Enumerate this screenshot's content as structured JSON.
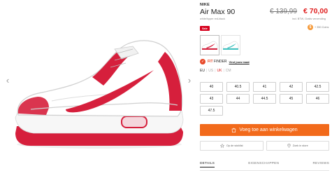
{
  "product": {
    "brand": "NIKE",
    "model": "Air Max 90",
    "old_price": "€ 139,99",
    "new_price": "€ 70,00",
    "color_name": "white/hyper red-black",
    "vat_note": "incl. BTW, Gratis verzending",
    "sale_badge": "Sale",
    "coins_text": "+ 350 Coins"
  },
  "fit_finder": {
    "label_brand": "FIT",
    "label_rest": " FINDER",
    "link": "Vind jouw maat"
  },
  "size_systems": [
    "EU",
    "US",
    "UK",
    "CM"
  ],
  "sizes": [
    "40",
    "40.5",
    "41",
    "42",
    "42.5",
    "43",
    "44",
    "44.5",
    "45",
    "46",
    "47.5"
  ],
  "actions": {
    "cart_button": "Voeg toe aan winkelwagen",
    "wishlist": "Op de wishlist",
    "store": "Zoek in store"
  },
  "tabs": [
    "DETAILS",
    "EIGENSCHAPPEN",
    "REVIEWS"
  ],
  "colors": {
    "accent_orange": "#f26a1b",
    "price_red": "#e02020",
    "shoe_red": "#d61f3c"
  },
  "icons": {
    "prev": "chevron-left-icon",
    "next": "chevron-right-icon",
    "cart": "shopping-bag-icon",
    "wishlist": "star-icon",
    "store": "location-pin-icon",
    "coins": "coin-icon",
    "fit": "fit-finder-icon"
  }
}
